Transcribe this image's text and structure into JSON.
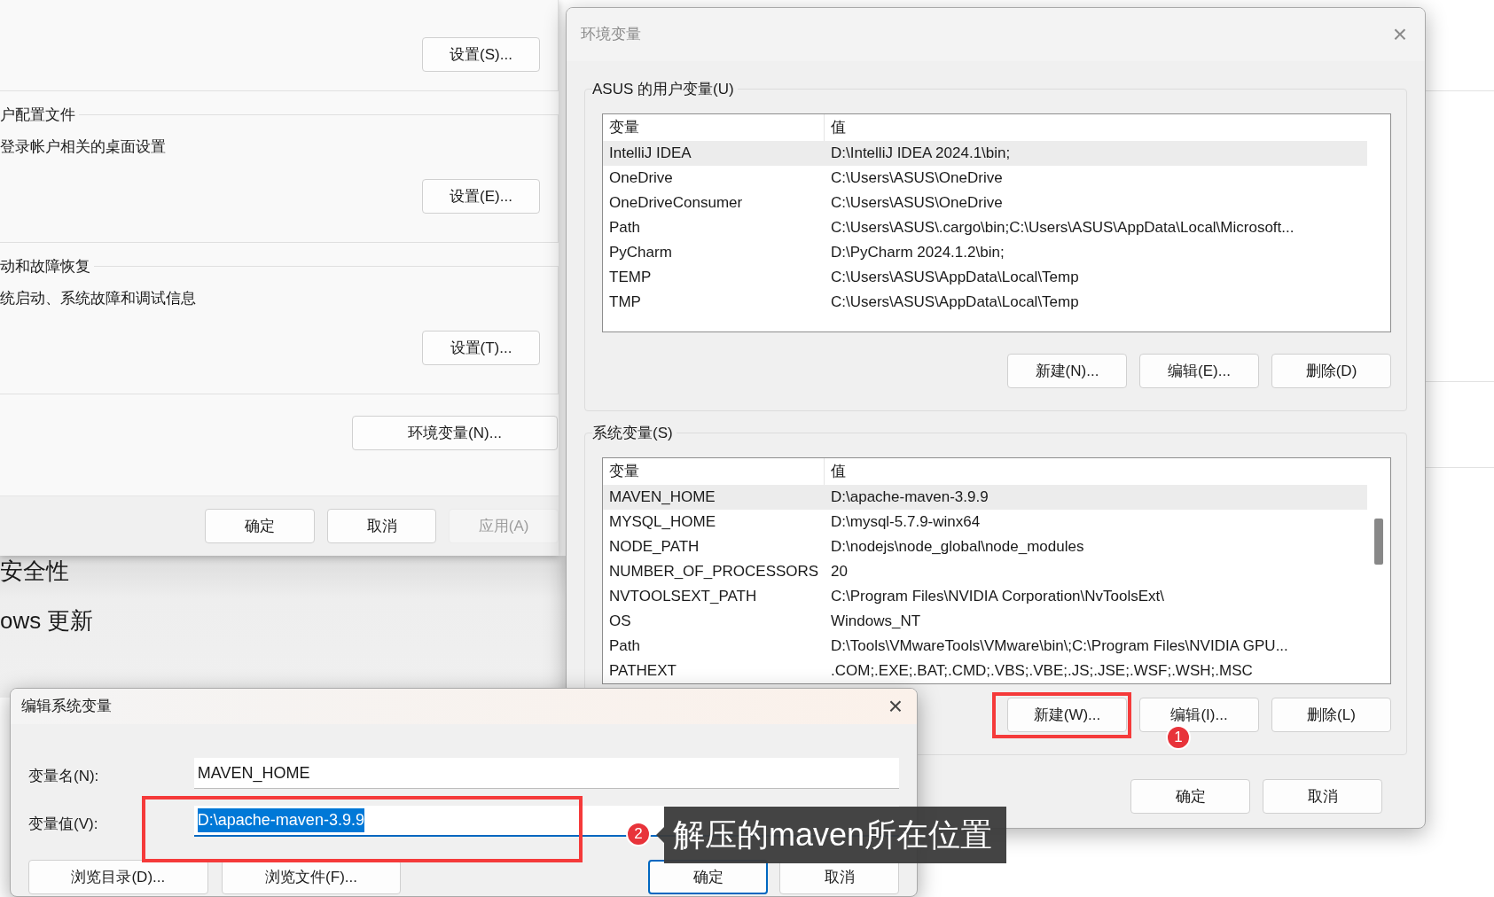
{
  "system_properties": {
    "sections": [
      {
        "button": "设置(S)..."
      },
      {
        "title": "户配置文件",
        "description": "登录帐户相关的桌面设置",
        "button": "设置(E)..."
      },
      {
        "title": "动和故障恢复",
        "description": "统启动、系统故障和调试信息",
        "button": "设置(T)..."
      }
    ],
    "env_button": "环境变量(N)...",
    "buttons": [
      {
        "label": "确定",
        "disabled": false
      },
      {
        "label": "取消",
        "disabled": false
      },
      {
        "label": "应用(A)",
        "disabled": true
      }
    ]
  },
  "background_settings": {
    "items": [
      "安全性",
      "ows 更新"
    ]
  },
  "env_dialog": {
    "title": "环境变量",
    "close": "×",
    "user_group": {
      "title": "ASUS 的用户变量(U)",
      "columns": [
        "变量",
        "值"
      ],
      "rows": [
        {
          "name": "IntelliJ IDEA",
          "value": "D:\\IntelliJ IDEA 2024.1\\bin;",
          "selected": true
        },
        {
          "name": "OneDrive",
          "value": "C:\\Users\\ASUS\\OneDrive",
          "selected": false
        },
        {
          "name": "OneDriveConsumer",
          "value": "C:\\Users\\ASUS\\OneDrive",
          "selected": false
        },
        {
          "name": "Path",
          "value": "C:\\Users\\ASUS\\.cargo\\bin;C:\\Users\\ASUS\\AppData\\Local\\Microsoft...",
          "selected": false
        },
        {
          "name": "PyCharm",
          "value": "D:\\PyCharm 2024.1.2\\bin;",
          "selected": false
        },
        {
          "name": "TEMP",
          "value": "C:\\Users\\ASUS\\AppData\\Local\\Temp",
          "selected": false
        },
        {
          "name": "TMP",
          "value": "C:\\Users\\ASUS\\AppData\\Local\\Temp",
          "selected": false
        }
      ],
      "buttons": [
        "新建(N)...",
        "编辑(E)...",
        "删除(D)"
      ]
    },
    "system_group": {
      "title": "系统变量(S)",
      "columns": [
        "变量",
        "值"
      ],
      "rows": [
        {
          "name": "MAVEN_HOME",
          "value": "D:\\apache-maven-3.9.9",
          "selected": true
        },
        {
          "name": "MYSQL_HOME",
          "value": "D:\\mysql-5.7.9-winx64",
          "selected": false
        },
        {
          "name": "NODE_PATH",
          "value": "D:\\nodejs\\node_global\\node_modules",
          "selected": false
        },
        {
          "name": "NUMBER_OF_PROCESSORS",
          "value": "20",
          "selected": false
        },
        {
          "name": "NVTOOLSEXT_PATH",
          "value": "C:\\Program Files\\NVIDIA Corporation\\NvToolsExt\\",
          "selected": false
        },
        {
          "name": "OS",
          "value": "Windows_NT",
          "selected": false
        },
        {
          "name": "Path",
          "value": "D:\\Tools\\VMwareTools\\VMware\\bin\\;C:\\Program Files\\NVIDIA GPU...",
          "selected": false
        },
        {
          "name": "PATHEXT",
          "value": ".COM;.EXE;.BAT;.CMD;.VBS;.VBE;.JS;.JSE;.WSF;.WSH;.MSC",
          "selected": false
        }
      ],
      "buttons": [
        "新建(W)...",
        "编辑(I)...",
        "删除(L)"
      ]
    },
    "buttons": [
      "确定",
      "取消"
    ]
  },
  "edit_dialog": {
    "title": "编辑系统变量",
    "close": "×",
    "fields": [
      {
        "label": "变量名(N):",
        "value": "MAVEN_HOME",
        "focused": false
      },
      {
        "label": "变量值(V):",
        "value": "D:\\apache-maven-3.9.9",
        "focused": true
      }
    ],
    "buttons": [
      {
        "label": "浏览目录(D)...",
        "default": false
      },
      {
        "label": "浏览文件(F)...",
        "default": false
      },
      {
        "label": "确定",
        "default": true
      },
      {
        "label": "取消",
        "default": false
      }
    ]
  },
  "annotations": [
    {
      "kind": "box"
    },
    {
      "kind": "badge",
      "text": "1"
    },
    {
      "kind": "box"
    },
    {
      "kind": "badge",
      "text": "2"
    },
    {
      "kind": "callout",
      "text": "解压的maven所在位置"
    }
  ]
}
